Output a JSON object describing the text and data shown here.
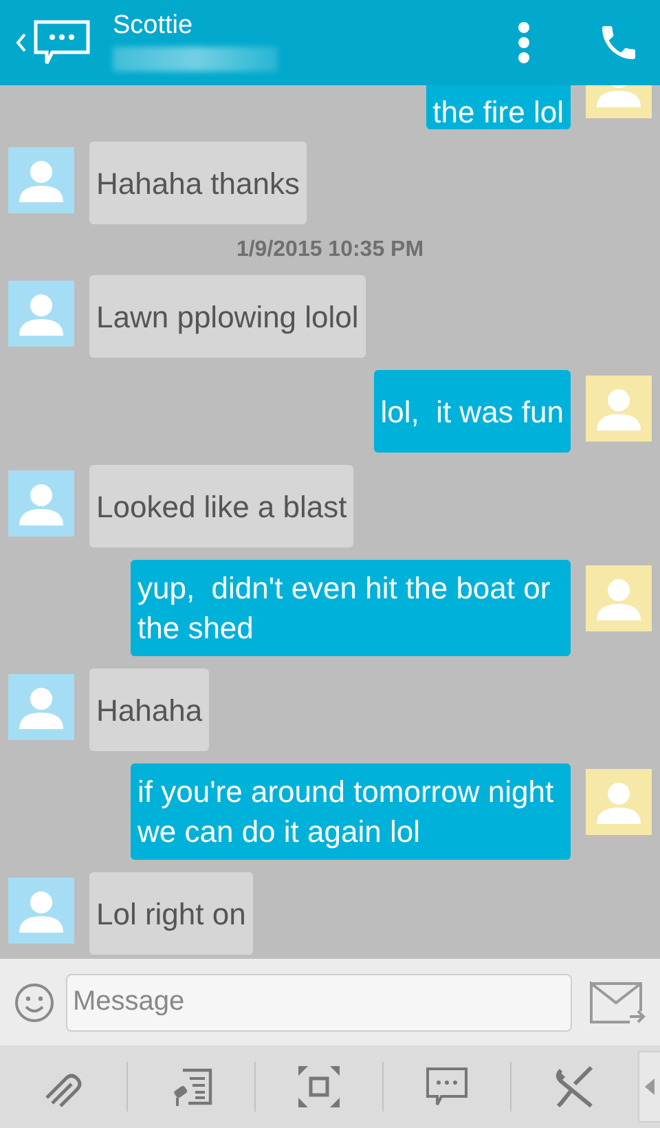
{
  "header": {
    "contact_name": "Scottie"
  },
  "messages": [
    {
      "kind": "outgoing",
      "text": "the fire lol"
    },
    {
      "kind": "incoming",
      "text": "Hahaha thanks"
    },
    {
      "kind": "timestamp",
      "text": "1/9/2015 10:35 PM"
    },
    {
      "kind": "incoming",
      "text": "Lawn pplowing lolol"
    },
    {
      "kind": "outgoing",
      "text": "lol,  it was fun"
    },
    {
      "kind": "incoming",
      "text": "Looked like a blast"
    },
    {
      "kind": "outgoing",
      "text": "yup,  didn't even hit the boat or the shed"
    },
    {
      "kind": "incoming",
      "text": "Hahaha"
    },
    {
      "kind": "outgoing",
      "text": "if you're around tomorrow night we can do it again lol"
    },
    {
      "kind": "incoming",
      "text": "Lol right on"
    }
  ],
  "composer": {
    "placeholder": "Message"
  }
}
